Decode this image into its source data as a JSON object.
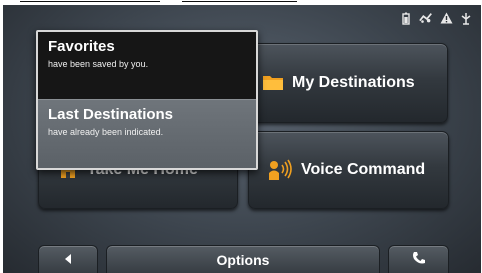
{
  "status_bar": {
    "icons": [
      "battery-icon",
      "signal-icon",
      "alert-icon",
      "antenna-icon"
    ]
  },
  "tiles": {
    "my_destinations": {
      "label": "My Destinations",
      "icon": "folder-icon",
      "color": "#f0a020"
    },
    "voice_command": {
      "label": "Voice Command",
      "icon": "voice-icon",
      "color": "#f0a020"
    },
    "take_me_home": {
      "label": "Take Me Home",
      "icon": "home-icon",
      "color": "#f0a020"
    }
  },
  "popup": {
    "favorites": {
      "title": "Favorites",
      "subtitle": "have been saved by you."
    },
    "last_destinations": {
      "title": "Last Destinations",
      "subtitle": "have already been indicated."
    }
  },
  "bottom_bar": {
    "back_icon": "left-arrow-icon",
    "options_label": "Options",
    "call_icon": "phone-icon"
  }
}
